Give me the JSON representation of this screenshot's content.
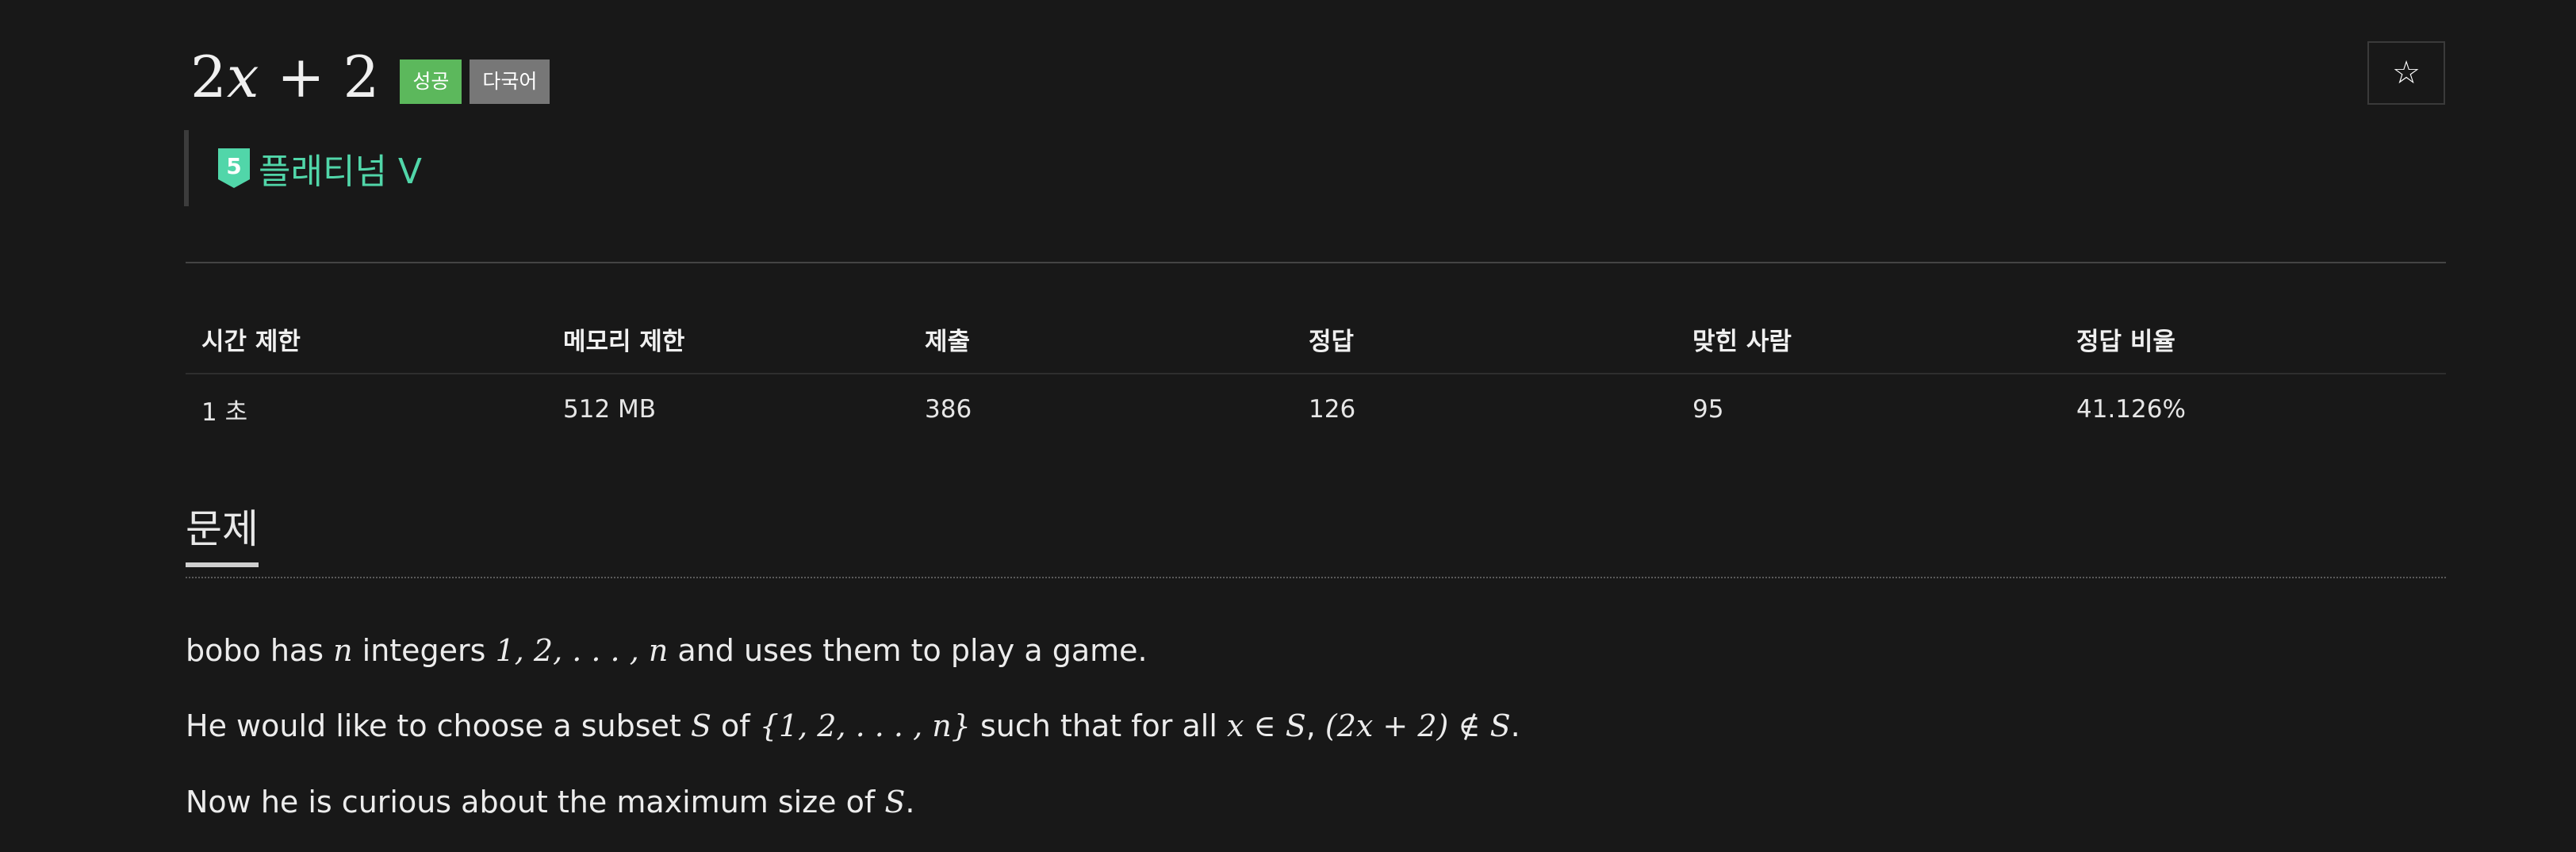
{
  "problem": {
    "title": "2x + 2",
    "title_parts": {
      "a": "2",
      "x": "x",
      "op": " + ",
      "b": "2"
    },
    "badges": {
      "success": "성공",
      "lang": "다국어"
    },
    "tier": {
      "number": "5",
      "label": "플래티넘 V",
      "color": "#51d6a9"
    },
    "star_icon": "star-outline-icon"
  },
  "stats": {
    "headers": [
      "시간 제한",
      "메모리 제한",
      "제출",
      "정답",
      "맞힌 사람",
      "정답 비율"
    ],
    "values": [
      "1 초",
      "512 MB",
      "386",
      "126",
      "95",
      "41.126%"
    ]
  },
  "section": {
    "title": "문제"
  },
  "statement": {
    "line1": {
      "t1": "bobo has ",
      "m1": "n",
      "t2": " integers ",
      "m2": "1, 2, . . . , n",
      "t3": " and uses them to play a game."
    },
    "line2": {
      "t1": "He would like to choose a subset ",
      "m1": "S",
      "t2": " of ",
      "m2": "{1, 2, . . . , n}",
      "t3": " such that for all ",
      "m3": "x ∈ S",
      "t4": ", ",
      "m4": "(2x + 2) ∉ S",
      "t5": "."
    },
    "line3": {
      "t1": "Now he is curious about the maximum size of ",
      "m1": "S",
      "t2": "."
    }
  },
  "colors": {
    "background": "#181818",
    "success": "#5cb85c",
    "lang": "#777777",
    "tier": "#51d6a9"
  }
}
